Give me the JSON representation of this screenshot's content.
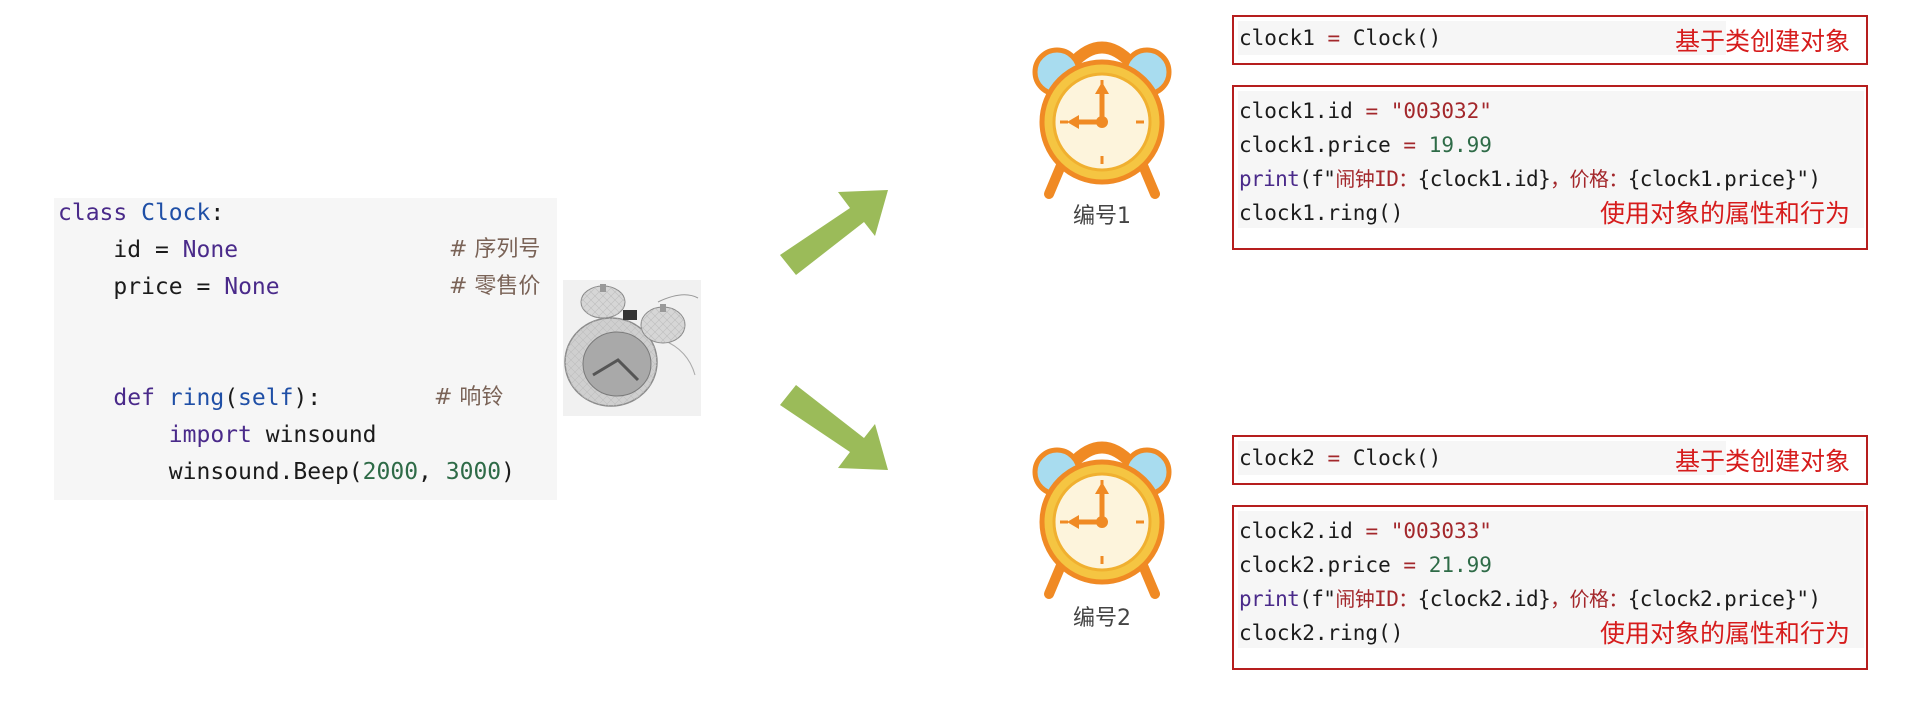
{
  "class_code": {
    "line1": {
      "kw": "class",
      "name": "Clock",
      "colon": ":"
    },
    "line2": {
      "attr": "id",
      "eq": "=",
      "val": "None",
      "comment": "# 序列号"
    },
    "line3": {
      "attr": "price",
      "eq": "=",
      "val": "None",
      "comment": "# 零售价"
    },
    "line4": {
      "kw": "def",
      "fn": "ring",
      "open": "(",
      "self": "self",
      "close": "):",
      "comment": "# 响铃"
    },
    "line5": {
      "kw": "import",
      "mod": "winsound"
    },
    "line6": {
      "call": "winsound.Beep(",
      "a1": "2000",
      "sep": ", ",
      "a2": "3000",
      "end": ")"
    }
  },
  "object1": {
    "caption": "编号1",
    "create": {
      "var": "clock1",
      "eq": "=",
      "call": "Clock()"
    },
    "create_label": "基于类创建对象",
    "id_line": {
      "lhs": "clock1.id",
      "eq": "=",
      "val": "\"003032\""
    },
    "price_line": {
      "lhs": "clock1.price",
      "eq": "=",
      "val": "19.99"
    },
    "print_line": {
      "fn": "print",
      "p1": "(f\"",
      "cn1": "闹钟",
      "id": "ID",
      "cn2": "：",
      "b1": "{clock1.id}",
      "cn3": "，价格：",
      "b2": "{clock1.price}",
      "end": "\")"
    },
    "ring_line": "clock1.ring()",
    "use_label": "使用对象的属性和行为"
  },
  "object2": {
    "caption": "编号2",
    "create": {
      "var": "clock2",
      "eq": "=",
      "call": "Clock()"
    },
    "create_label": "基于类创建对象",
    "id_line": {
      "lhs": "clock2.id",
      "eq": "=",
      "val": "\"003033\""
    },
    "price_line": {
      "lhs": "clock2.price",
      "eq": "=",
      "val": "21.99"
    },
    "print_line": {
      "fn": "print",
      "p1": "(f\"",
      "cn1": "闹钟",
      "id": "ID",
      "cn2": "：",
      "b1": "{clock2.id}",
      "cn3": "，价格：",
      "b2": "{clock2.price}",
      "end": "\")"
    },
    "ring_line": "clock2.ring()",
    "use_label": "使用对象的属性和行为"
  },
  "colors": {
    "arrow": "#9bbb59",
    "box_border": "#b61e1e",
    "label_red": "#d61c1c",
    "clock_orange": "#f08a24",
    "clock_blue": "#a8dcef",
    "clock_face": "#fdf4dc"
  },
  "icons": {
    "photo": "alarm-clock-3d-photo-icon",
    "clock": "alarm-clock-icon",
    "arrow": "arrow-icon"
  }
}
